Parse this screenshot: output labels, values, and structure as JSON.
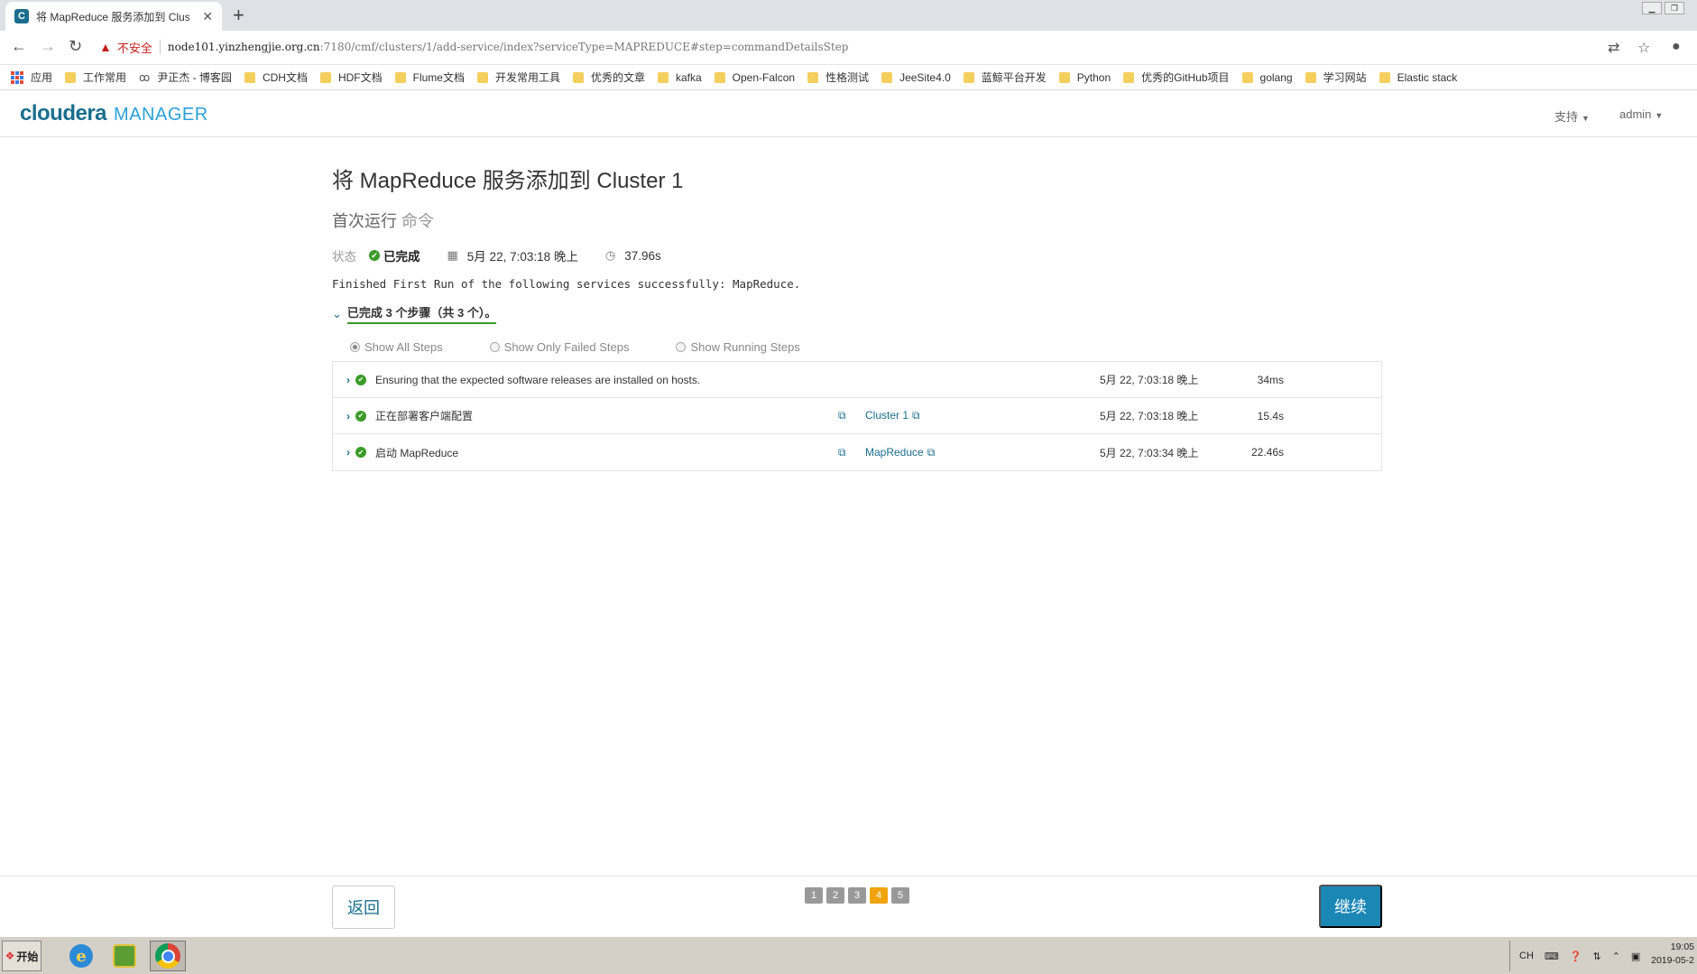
{
  "browser": {
    "tab_title": "将 MapReduce 服务添加到 Clust",
    "tab_favicon": "C",
    "new_tab": "+",
    "insecure_label": "不安全",
    "url_host": "node101.yinzhengjie.org.cn",
    "url_path": ":7180/cmf/clusters/1/add-service/index?serviceType=MAPREDUCE#step=commandDetailsStep",
    "bookmarks": [
      "应用",
      "工作常用",
      "尹正杰 - 博客园",
      "CDH文档",
      "HDF文档",
      "Flume文档",
      "开发常用工具",
      "优秀的文章",
      "kafka",
      "Open-Falcon",
      "性格测试",
      "JeeSite4.0",
      "蓝鲸平台开发",
      "Python",
      "优秀的GitHub项目",
      "golang",
      "学习网站",
      "Elastic stack"
    ]
  },
  "header": {
    "logo_cloudera": "cloudera",
    "logo_manager": "MANAGER",
    "support_menu": "支持",
    "user_menu": "admin"
  },
  "main": {
    "title": "将 MapReduce 服务添加到 Cluster 1",
    "subtitle_main": "首次运行",
    "subtitle_muted": "命令",
    "status_label": "状态",
    "status_value": "已完成",
    "start_time": "5月 22, 7:03:18 晚上",
    "duration": "37.96s",
    "message": "Finished First Run of the following services successfully: MapReduce.",
    "steps_summary": "已完成 3 个步骤（共 3 个）。",
    "filters": [
      "Show All Steps",
      "Show Only Failed Steps",
      "Show Running Steps"
    ],
    "steps": [
      {
        "description": "Ensuring that the expected software releases are installed on hosts.",
        "link": "",
        "time": "5月 22, 7:03:18 晚上",
        "duration": "34ms"
      },
      {
        "description": "正在部署客户端配置",
        "link": "Cluster 1",
        "time": "5月 22, 7:03:18 晚上",
        "duration": "15.4s"
      },
      {
        "description": "启动 MapReduce",
        "link": "MapReduce",
        "time": "5月 22, 7:03:34 晚上",
        "duration": "22.46s"
      }
    ]
  },
  "footer": {
    "back_label": "返回",
    "next_label": "继续",
    "pages": [
      "1",
      "2",
      "3",
      "4",
      "5"
    ],
    "active_page": "4"
  },
  "taskbar": {
    "start_label": "开始",
    "tray_lang": "CH",
    "clock_time": "19:05",
    "clock_date": "2019-05-2"
  },
  "colors": {
    "accent": "#1a6e8e",
    "success": "#3b9b29",
    "primary_button": "#1b87b5",
    "active_page": "#f0a30a"
  }
}
